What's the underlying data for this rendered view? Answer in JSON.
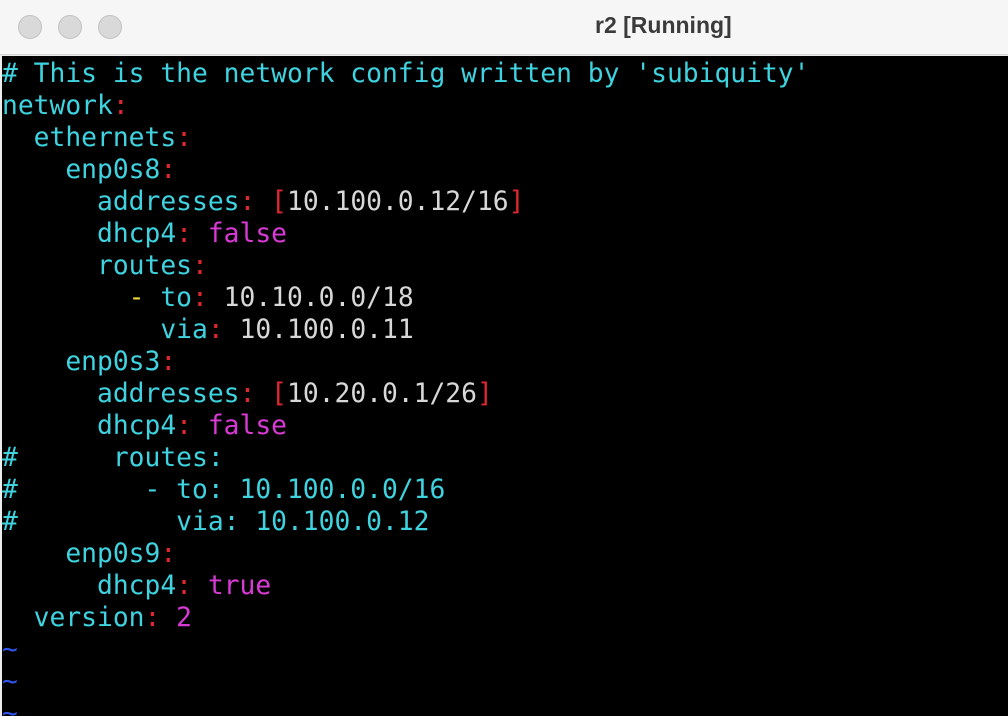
{
  "window": {
    "title": "r2 [Running]"
  },
  "editor": {
    "lines": [
      [
        {
          "t": "# This is the network config written by 'subiquity'",
          "c": "c"
        }
      ],
      [
        {
          "t": "network",
          "c": "c"
        },
        {
          "t": ":",
          "c": "r"
        }
      ],
      [
        {
          "t": "  ethernets",
          "c": "c"
        },
        {
          "t": ":",
          "c": "r"
        }
      ],
      [
        {
          "t": "    enp0s8",
          "c": "c"
        },
        {
          "t": ":",
          "c": "r"
        }
      ],
      [
        {
          "t": "      addresses",
          "c": "c"
        },
        {
          "t": ": [",
          "c": "r"
        },
        {
          "t": "10.100.0.12/16",
          "c": "w"
        },
        {
          "t": "]",
          "c": "r"
        }
      ],
      [
        {
          "t": "      dhcp4",
          "c": "c"
        },
        {
          "t": ": ",
          "c": "r"
        },
        {
          "t": "false",
          "c": "m"
        }
      ],
      [
        {
          "t": "      routes",
          "c": "c"
        },
        {
          "t": ":",
          "c": "r"
        }
      ],
      [
        {
          "t": "        - ",
          "c": "y"
        },
        {
          "t": "to",
          "c": "c"
        },
        {
          "t": ": ",
          "c": "r"
        },
        {
          "t": "10.10.0.0/18",
          "c": "w"
        }
      ],
      [
        {
          "t": "          via",
          "c": "c"
        },
        {
          "t": ": ",
          "c": "r"
        },
        {
          "t": "10.100.0.11",
          "c": "w"
        }
      ],
      [
        {
          "t": "    enp0s3",
          "c": "c"
        },
        {
          "t": ":",
          "c": "r"
        }
      ],
      [
        {
          "t": "      addresses",
          "c": "c"
        },
        {
          "t": ": [",
          "c": "r"
        },
        {
          "t": "10.20.0.1/26",
          "c": "w"
        },
        {
          "t": "]",
          "c": "r"
        }
      ],
      [
        {
          "t": "      dhcp4",
          "c": "c"
        },
        {
          "t": ": ",
          "c": "r"
        },
        {
          "t": "false",
          "c": "m"
        }
      ],
      [
        {
          "t": "#      routes:",
          "c": "c"
        }
      ],
      [
        {
          "t": "#        - to: 10.100.0.0/16",
          "c": "c"
        }
      ],
      [
        {
          "t": "#          via: 10.100.0.12",
          "c": "c"
        }
      ],
      [
        {
          "t": "    enp0s9",
          "c": "c"
        },
        {
          "t": ":",
          "c": "r"
        }
      ],
      [
        {
          "t": "      dhcp4",
          "c": "c"
        },
        {
          "t": ": ",
          "c": "r"
        },
        {
          "t": "true",
          "c": "m"
        }
      ],
      [
        {
          "t": "  version",
          "c": "c"
        },
        {
          "t": ": ",
          "c": "r"
        },
        {
          "t": "2",
          "c": "m"
        }
      ],
      [
        {
          "t": "~",
          "c": "b"
        }
      ],
      [
        {
          "t": "~",
          "c": "b"
        }
      ],
      [
        {
          "t": "~",
          "c": "b"
        }
      ]
    ]
  }
}
